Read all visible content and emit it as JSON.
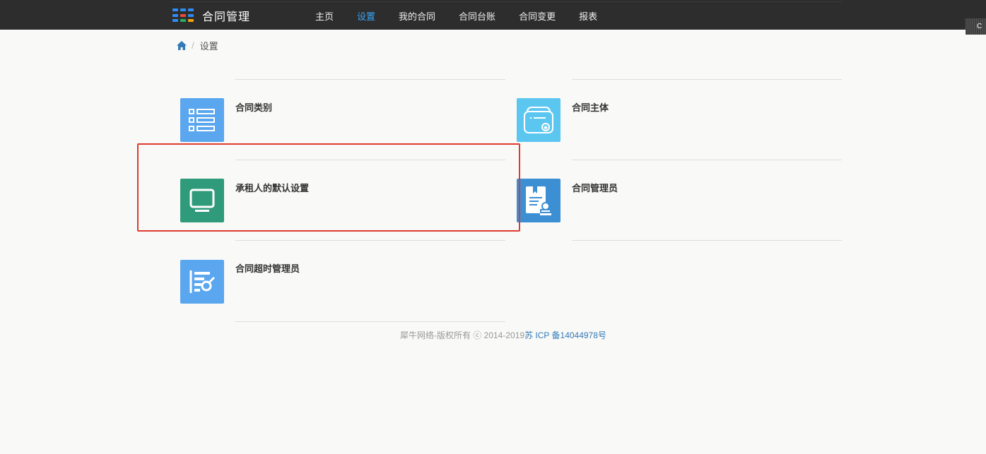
{
  "app": {
    "title": "合同管理",
    "brand_colors": [
      "#2e8df5",
      "#e84b3c",
      "#27ae60",
      "#f1a20d"
    ]
  },
  "nav": {
    "items": [
      {
        "label": "主页",
        "active": false
      },
      {
        "label": "设置",
        "active": true
      },
      {
        "label": "我的合同",
        "active": false
      },
      {
        "label": "合同台账",
        "active": false
      },
      {
        "label": "合同变更",
        "active": false
      },
      {
        "label": "报表",
        "active": false
      }
    ]
  },
  "corner_tab": {
    "label": "C"
  },
  "breadcrumb": {
    "home_icon": "home-icon",
    "current": "设置"
  },
  "tiles": [
    {
      "title": "合同类别",
      "icon": "list-icon",
      "color": "#5aa6ef"
    },
    {
      "title": "合同主体",
      "icon": "certificate-icon",
      "color": "#5bc7f0"
    },
    {
      "title": "承租人的默认设置",
      "icon": "monitor-icon",
      "color": "#2f9b7a"
    },
    {
      "title": "合同管理员",
      "icon": "document-stamp-icon",
      "color": "#3d8fd4"
    },
    {
      "title": "合同超时管理员",
      "icon": "chart-search-icon",
      "color": "#5aa6ef"
    }
  ],
  "footer": {
    "copyright": "犀牛网络-版权所有 ⓒ 2014-2019",
    "icp_link": "苏 ICP 备14044978号"
  },
  "highlight_color": "#e03a2f"
}
